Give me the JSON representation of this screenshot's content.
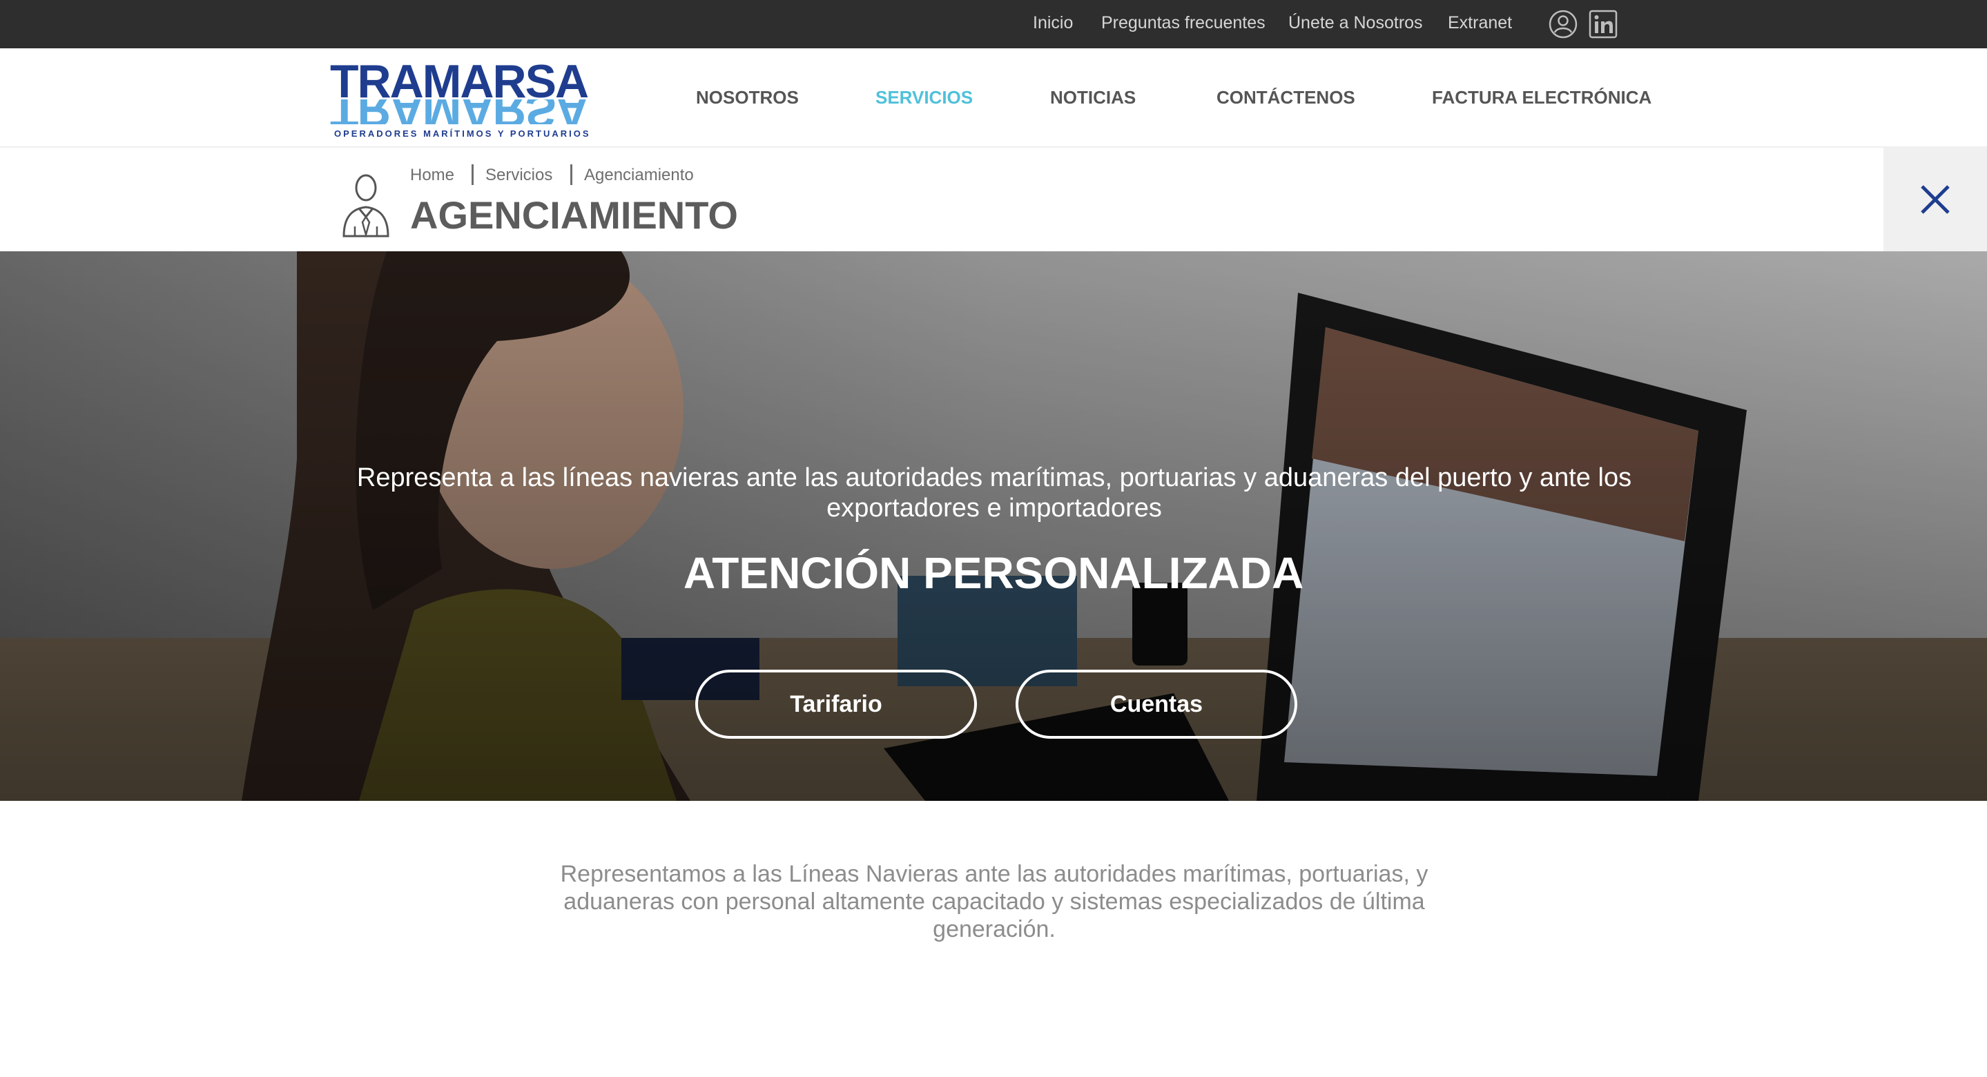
{
  "topbar": {
    "links": [
      "Inicio",
      "Preguntas frecuentes",
      "Únete a Nosotros",
      "Extranet"
    ],
    "icons": [
      "user-icon",
      "linkedin-icon"
    ]
  },
  "brand": {
    "name": "TRAMARSA",
    "tagline": "OPERADORES MARÍTIMOS Y PORTUARIOS",
    "colors": {
      "primary": "#1f3d8f",
      "secondary": "#4aa3df"
    }
  },
  "nav": {
    "items": [
      "NOSOTROS",
      "SERVICIOS",
      "NOTICIAS",
      "CONTÁCTENOS",
      "FACTURA ELECTRÓNICA"
    ],
    "active": "SERVICIOS",
    "active_color": "#4fc1d9"
  },
  "breadcrumb": [
    "Home",
    "Servicios",
    "Agenciamiento"
  ],
  "page": {
    "title": "AGENCIAMIENTO",
    "icon": "businessman-icon",
    "close_icon": "close-icon"
  },
  "hero": {
    "description": "Representa a las líneas navieras ante las autoridades marítimas, portuarias y aduaneras del puerto y ante los exportadores e importadores",
    "title": "ATENCIÓN PERSONALIZADA",
    "buttons": [
      "Tarifario",
      "Cuentas"
    ]
  },
  "intro": "Representamos a las Líneas Navieras ante las autoridades marítimas, portuarias, y aduaneras con personal altamente capacitado y sistemas especializados de última generación."
}
